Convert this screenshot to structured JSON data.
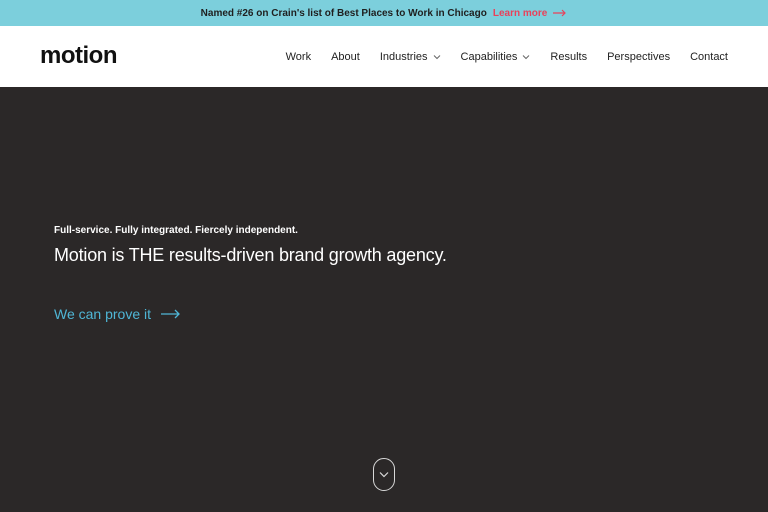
{
  "announcement": {
    "text": "Named #26 on Crain's list of Best Places to Work in Chicago",
    "link_label": "Learn more",
    "link_icon": "arrow-right-icon"
  },
  "header": {
    "logo": "motion",
    "nav": [
      {
        "label": "Work",
        "has_dropdown": false
      },
      {
        "label": "About",
        "has_dropdown": false
      },
      {
        "label": "Industries",
        "has_dropdown": true
      },
      {
        "label": "Capabilities",
        "has_dropdown": true
      },
      {
        "label": "Results",
        "has_dropdown": false
      },
      {
        "label": "Perspectives",
        "has_dropdown": false
      },
      {
        "label": "Contact",
        "has_dropdown": false
      }
    ]
  },
  "hero": {
    "tagline": "Full-service. Fully integrated. Fiercely independent.",
    "headline": "Motion is THE results-driven brand growth agency.",
    "cta_label": "We can prove it",
    "cta_icon": "arrow-right-icon",
    "scroll_icon": "chevron-down-icon"
  },
  "colors": {
    "announcement_bg": "#7ccfdc",
    "link_accent": "#e9415a",
    "hero_bg": "#2b2828",
    "cta_color": "#4fb6d6"
  }
}
